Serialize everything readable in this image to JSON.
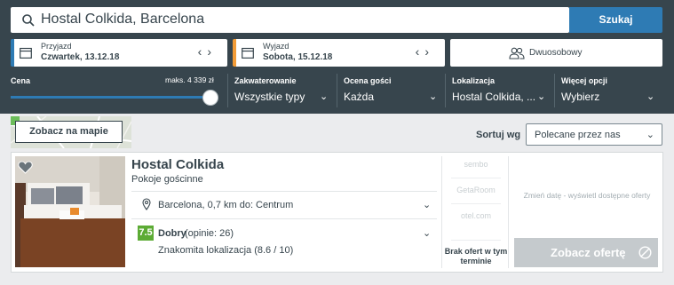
{
  "search": {
    "query": "Hostal Colkida, Barcelona",
    "button_label": "Szukaj"
  },
  "dates": {
    "checkin": {
      "label": "Przyjazd",
      "value": "Czwartek, 13.12.18"
    },
    "checkout": {
      "label": "Wyjazd",
      "value": "Sobota, 15.12.18"
    },
    "prev_symbol": "‹",
    "next_symbol": "›"
  },
  "room": {
    "label": "Dwuosobowy"
  },
  "filters": {
    "price": {
      "label": "Cena",
      "max_label": "maks. 4 339 zł",
      "level": 1.0
    },
    "accommodation": {
      "label": "Zakwaterowanie",
      "value": "Wszystkie typy"
    },
    "guest_rating": {
      "label": "Ocena gości",
      "value": "Każda"
    },
    "location": {
      "label": "Lokalizacja",
      "value": "Hostal Colkida, ..."
    },
    "more": {
      "label": "Więcej opcji",
      "value": "Wybierz"
    }
  },
  "map": {
    "button_label": "Zobacz na mapie"
  },
  "sort": {
    "label": "Sortuj wg",
    "value": "Polecane przez nas"
  },
  "hotel": {
    "name": "Hostal Colkida",
    "type": "Pokoje gościnne",
    "location": "Barcelona, 0,7 km do: Centrum",
    "rating_score": "7.5",
    "rating_word": "Dobry",
    "rating_count": "(opinie: 26)",
    "rating_detail": "Znakomita lokalizacja (8.6 / 10)"
  },
  "providers": [
    "sembo",
    "GetaRoom",
    "otel.com"
  ],
  "no_offers": "Brak ofert w tym terminie",
  "change_date": "Zmień datę - wyświetl dostępne oferty",
  "offer_button": "Zobacz ofertę",
  "colors": {
    "topbar": "#37454d",
    "accent_blue": "#2e7bb4",
    "checkout_orange": "#f39c37",
    "rating_green": "#5cab34",
    "disabled_button": "#c5cacd"
  }
}
